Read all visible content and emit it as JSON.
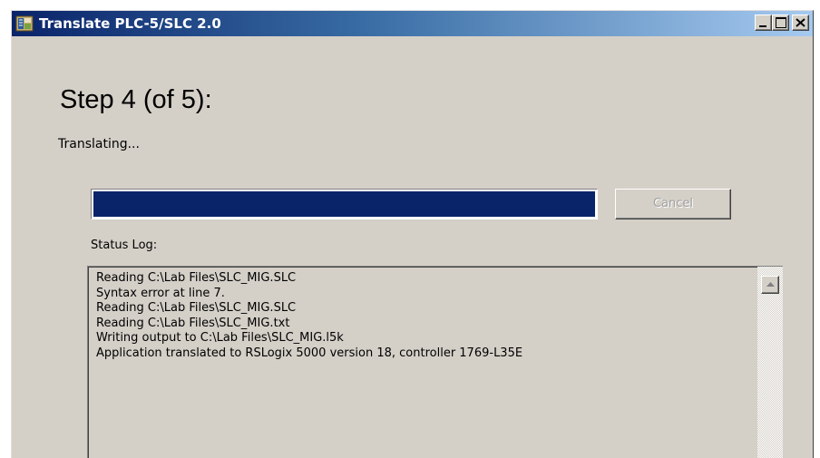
{
  "window": {
    "title": "Translate PLC-5/SLC 2.0"
  },
  "step": {
    "heading": "Step 4 (of 5):",
    "subtext": "Translating..."
  },
  "progress": {
    "value_percent": 100
  },
  "cancel_button": {
    "label": "Cancel",
    "enabled": false
  },
  "status_log": {
    "label": "Status Log:",
    "lines": [
      "Reading C:\\Lab Files\\SLC_MIG.SLC",
      "Syntax error at line 7.",
      "Reading C:\\Lab Files\\SLC_MIG.SLC",
      "Reading C:\\Lab Files\\SLC_MIG.txt",
      "Writing output to C:\\Lab Files\\SLC_MIG.l5k",
      "Application translated to RSLogix 5000 version 18, controller 1769-L35E"
    ]
  },
  "icons": {
    "app": "app-icon",
    "minimize": "minimize-icon",
    "maximize": "maximize-icon",
    "close": "close-icon",
    "scroll_up": "scroll-up-arrow-icon"
  },
  "colors": {
    "titlebar_start": "#0a246a",
    "titlebar_end": "#a6caf0",
    "progress_fill": "#0a246a",
    "window_face": "#d4d0c8"
  }
}
